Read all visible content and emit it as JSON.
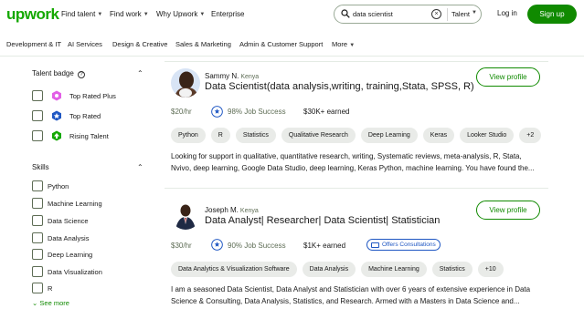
{
  "header": {
    "logo": "upwork",
    "nav": [
      "Find talent",
      "Find work",
      "Why Upwork",
      "Enterprise"
    ],
    "search_value": "data scientist",
    "search_scope": "Talent",
    "login": "Log in",
    "signup": "Sign up",
    "colors": {
      "brand": "#14a800",
      "button": "#108a00"
    }
  },
  "categories": [
    "Development & IT",
    "AI Services",
    "Design & Creative",
    "Sales & Marketing",
    "Admin & Customer Support",
    "More"
  ],
  "sidebar": {
    "talent_badge": {
      "heading": "Talent badge",
      "items": [
        {
          "label": "Top Rated Plus",
          "icon": "top-rated-plus-badge-icon",
          "color": "#e25fe6"
        },
        {
          "label": "Top Rated",
          "icon": "top-rated-badge-icon",
          "color": "#1f57c3"
        },
        {
          "label": "Rising Talent",
          "icon": "rising-talent-badge-icon",
          "color": "#14a800"
        }
      ]
    },
    "skills": {
      "heading": "Skills",
      "items": [
        "Python",
        "Machine Learning",
        "Data Science",
        "Data Analysis",
        "Deep Learning",
        "Data Visualization",
        "R"
      ],
      "see_more": "See more"
    }
  },
  "freelancers": [
    {
      "name": "Sammy N.",
      "country": "Kenya",
      "title": "Data Scientist(data analysis,writing, training,Stata, SPSS, R)",
      "rate": "$20/hr",
      "job_success": "98% Job Success",
      "earned": "$30K+ earned",
      "view_label": "View profile",
      "skills": [
        "Python",
        "R",
        "Statistics",
        "Qualitative Research",
        "Deep Learning",
        "Keras",
        "Looker Studio",
        "+2"
      ],
      "description_line1": "Looking for support in qualitative, quantitative research, writing, Systematic reviews, meta-analysis, R, Stata,",
      "description_line2": "Nvivo, deep learning, Google Data Studio, deep learning, Keras Python, machine learning. You have found the..."
    },
    {
      "name": "Joseph M.",
      "country": "Kenya",
      "title": "Data Analyst| Researcher| Data Scientist| Statistician",
      "rate": "$30/hr",
      "job_success": "90% Job Success",
      "earned": "$1K+ earned",
      "offer": "Offers Consultations",
      "view_label": "View profile",
      "skills": [
        "Data Analytics & Visualization Software",
        "Data Analysis",
        "Machine Learning",
        "Statistics",
        "+10"
      ],
      "description_line1": "I am a seasoned Data Scientist, Data Analyst and Statistician with over 6 years of extensive experience in Data",
      "description_line2": "Science & Consulting, Data Analysis, Statistics, and Research. Armed with a Masters in Data Science and..."
    }
  ]
}
